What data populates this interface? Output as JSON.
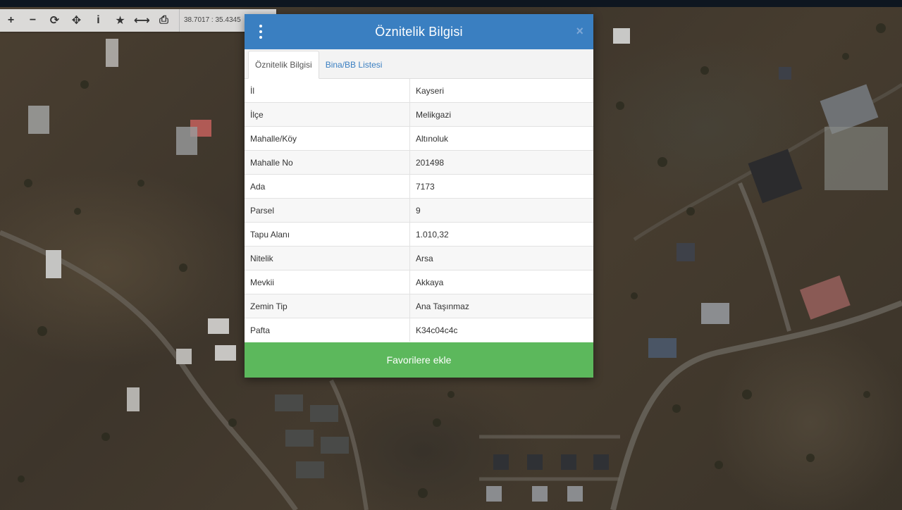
{
  "toolbar": {
    "tools": [
      {
        "name": "zoom-in-icon",
        "glyph": "+"
      },
      {
        "name": "zoom-out-icon",
        "glyph": "−"
      },
      {
        "name": "refresh-icon",
        "glyph": "⟳"
      },
      {
        "name": "move-icon",
        "glyph": "✥"
      },
      {
        "name": "info-icon",
        "glyph": "i"
      },
      {
        "name": "star-icon",
        "glyph": "★"
      },
      {
        "name": "measure-icon",
        "glyph": "⟷"
      },
      {
        "name": "print-icon",
        "glyph": "⎙"
      }
    ],
    "coordinates": "38.7017 : 35.4345"
  },
  "dialog": {
    "title": "Öznitelik Bilgisi",
    "tabs": [
      {
        "label": "Öznitelik Bilgisi",
        "active": true
      },
      {
        "label": "Bina/BB Listesi",
        "active": false
      }
    ],
    "rows": [
      {
        "key": "İl",
        "value": "Kayseri"
      },
      {
        "key": "İlçe",
        "value": "Melikgazi"
      },
      {
        "key": "Mahalle/Köy",
        "value": "Altınoluk"
      },
      {
        "key": "Mahalle No",
        "value": "201498"
      },
      {
        "key": "Ada",
        "value": "7173"
      },
      {
        "key": "Parsel",
        "value": "9"
      },
      {
        "key": "Tapu Alanı",
        "value": "1.010,32"
      },
      {
        "key": "Nitelik",
        "value": "Arsa"
      },
      {
        "key": "Mevkii",
        "value": "Akkaya"
      },
      {
        "key": "Zemin Tip",
        "value": "Ana Taşınmaz"
      },
      {
        "key": "Pafta",
        "value": "K34c04c4c"
      }
    ],
    "favorite_label": "Favorilere ekle",
    "close_glyph": "×"
  },
  "colors": {
    "header": "#3a7fc1",
    "favorite_button": "#5cb85c",
    "tab_link": "#3a7fc1"
  }
}
